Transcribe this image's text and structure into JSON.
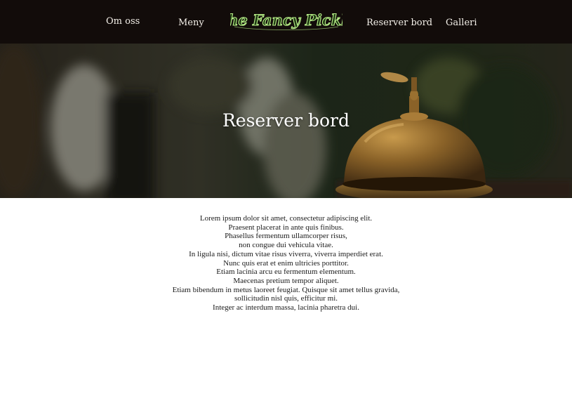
{
  "nav": {
    "items": [
      {
        "label": "Om oss"
      },
      {
        "label": "Meny"
      },
      {
        "label": "Reserver bord"
      },
      {
        "label": "Galleri"
      }
    ],
    "logo_text": "The Fancy Pickle"
  },
  "colors": {
    "nav_background": "#120c0a",
    "nav_text": "#f3efe8",
    "logo_fill": "#1f3b12",
    "logo_stroke": "#b9f08a",
    "hero_text": "#ffffff",
    "body_text": "#1a1a1a"
  },
  "hero": {
    "title": "Reserver bord"
  },
  "content": {
    "lines": [
      "Lorem ipsum dolor sit amet, consectetur adipiscing elit.",
      "Praesent placerat in ante quis finibus.",
      "Phasellus fermentum ullamcorper risus,",
      "non congue dui vehicula vitae.",
      "In ligula nisi, dictum vitae risus viverra, viverra imperdiet erat.",
      "Nunc quis erat et enim ultricies porttitor.",
      "Etiam lacinia arcu eu fermentum elementum.",
      "Maecenas pretium tempor aliquet.",
      "Etiam bibendum in metus laoreet feugiat. Quisque sit amet tellus gravida,",
      "sollicitudin nisl quis, efficitur mi.",
      "Integer ac interdum massa, lacinia pharetra dui."
    ]
  }
}
